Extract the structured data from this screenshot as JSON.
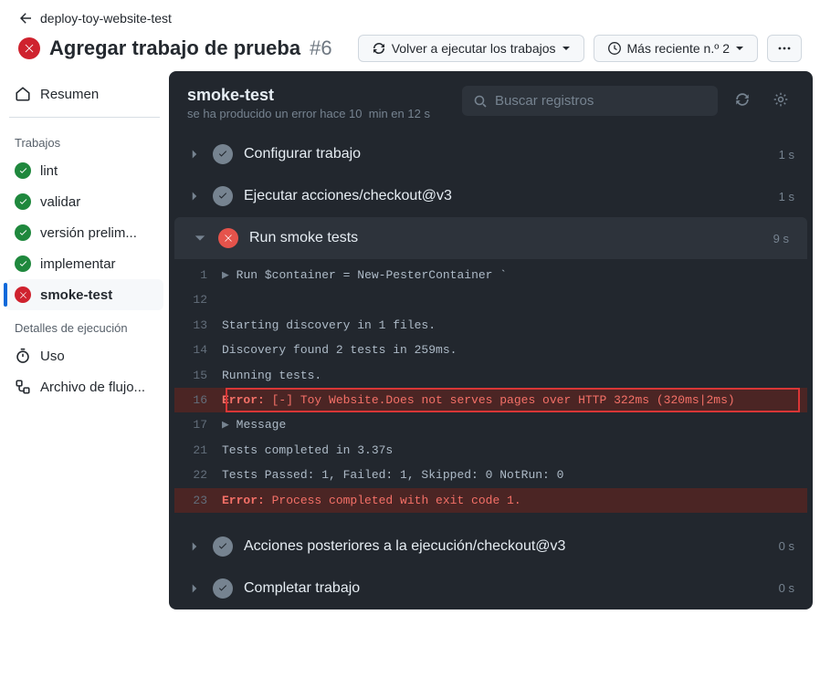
{
  "header": {
    "back_label": "deploy-toy-website-test",
    "title": "Agregar trabajo de prueba",
    "run_number": "#6",
    "rerun_btn": "Volver a ejecutar los trabajos",
    "recent_btn": "Más reciente n.º 2"
  },
  "sidebar": {
    "summary": "Resumen",
    "jobs_header": "Trabajos",
    "jobs": [
      {
        "label": "lint",
        "status": "success"
      },
      {
        "label": "validar",
        "status": "success"
      },
      {
        "label": "versión prelim...",
        "status": "success"
      },
      {
        "label": "implementar",
        "status": "success"
      },
      {
        "label": "smoke-test",
        "status": "fail",
        "selected": true
      }
    ],
    "details_header": "Detalles de ejecución",
    "usage": "Uso",
    "workflow_file": "Archivo de flujo..."
  },
  "job": {
    "title": "smoke-test",
    "subtitle": "se ha producido un error hace 10  min en 12 s",
    "search_placeholder": "Buscar registros"
  },
  "steps": [
    {
      "label": "Configurar trabajo",
      "status": "ok",
      "time": "1 s",
      "expanded": false
    },
    {
      "label": "Ejecutar acciones/checkout@v3",
      "status": "ok",
      "time": "1 s",
      "expanded": false
    },
    {
      "label": "Run smoke tests",
      "status": "err",
      "time": "9 s",
      "expanded": true
    },
    {
      "label": "Acciones posteriores a la ejecución/checkout@v3",
      "status": "ok",
      "time": "0 s",
      "expanded": false
    },
    {
      "label": "Completar trabajo",
      "status": "ok",
      "time": "0 s",
      "expanded": false
    }
  ],
  "log": {
    "lines": [
      {
        "n": "1",
        "disclosure": true,
        "text": "Run $container = New-PesterContainer `"
      },
      {
        "n": "12",
        "text": ""
      },
      {
        "n": "13",
        "text": "Starting discovery in 1 files."
      },
      {
        "n": "14",
        "text": "Discovery found 2 tests in 259ms."
      },
      {
        "n": "15",
        "text": "Running tests."
      },
      {
        "n": "16",
        "error": true,
        "boxed": true,
        "err_label": "Error:",
        "text": " [-] Toy Website.Does not serves pages over HTTP 322ms (320ms|2ms)"
      },
      {
        "n": "17",
        "disclosure": true,
        "text": "Message"
      },
      {
        "n": "21",
        "text": "Tests completed in 3.37s"
      },
      {
        "n": "22",
        "text": "Tests Passed: 1, Failed: 1, Skipped: 0 NotRun: 0"
      },
      {
        "n": "23",
        "error": true,
        "err_label": "Error:",
        "text": " Process completed with exit code 1."
      }
    ]
  }
}
